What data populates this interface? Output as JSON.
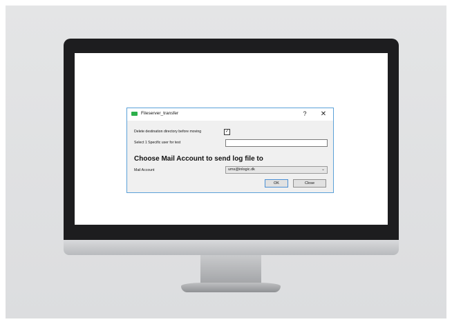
{
  "dialog": {
    "title": "Fileserver_transfer",
    "help": "?",
    "close": "✕",
    "delete_label": "Delete destination directory before moving",
    "delete_checked": "✓",
    "user_label": "Select 1 Specific user for test",
    "user_value": "",
    "heading": "Choose Mail Account to send log file to",
    "mail_label": "Mail Account",
    "mail_value": "ums@inlogic.dk",
    "mail_arrow": "⌄",
    "ok_label": "OK",
    "close_label": "Close"
  }
}
